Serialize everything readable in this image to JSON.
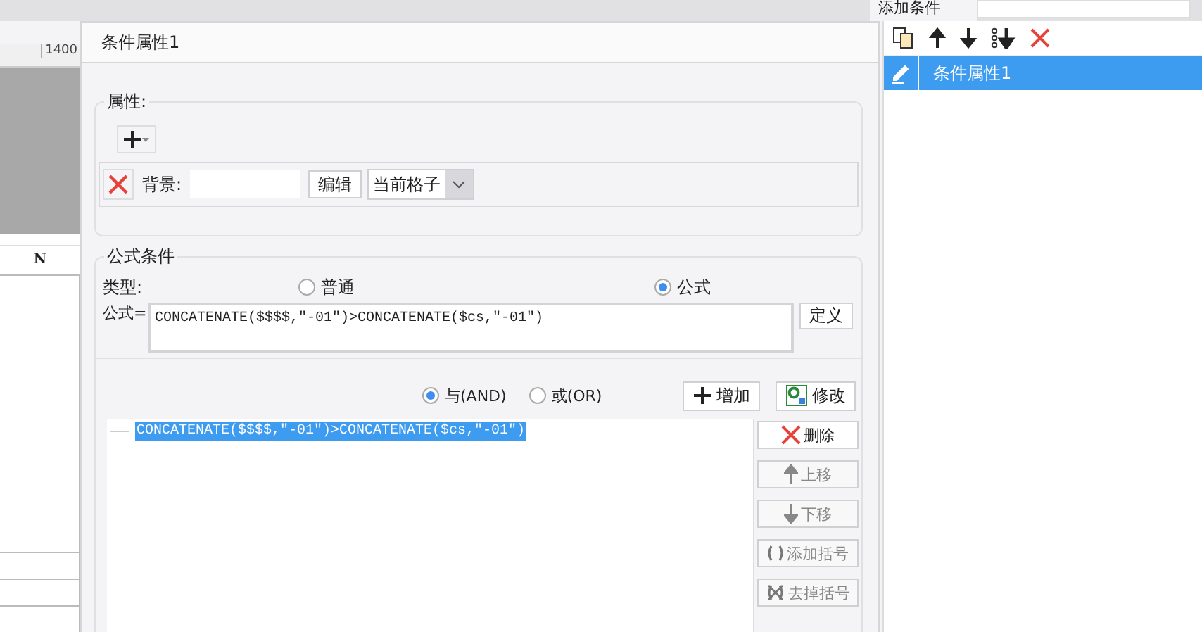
{
  "left_pane": {
    "ruler_label": "1400",
    "column_header": "N"
  },
  "dialog": {
    "title": "条件属性1",
    "properties": {
      "legend": "属性:",
      "items": [
        {
          "label": "背景:",
          "edit_button": "编辑",
          "scope": "当前格子"
        }
      ]
    },
    "formula_condition": {
      "legend": "公式条件",
      "type_label": "类型:",
      "types": [
        {
          "label": "普通",
          "selected": false
        },
        {
          "label": "公式",
          "selected": true
        }
      ],
      "formula_label": "公式=",
      "formula": "CONCATENATE($$$$,\"-01\")>CONCATENATE($cs,\"-01\")",
      "define_button": "定义"
    },
    "logic": [
      {
        "label": "与(AND)",
        "selected": true
      },
      {
        "label": "或(OR)",
        "selected": false
      }
    ],
    "add_button": "增加",
    "modify_button": "修改",
    "conditions": [
      {
        "text": "CONCATENATE($$$$,\"-01\")>CONCATENATE($cs,\"-01\")",
        "selected": true
      }
    ],
    "side_buttons": [
      {
        "label": "删除",
        "kind": "delete",
        "disabled": false
      },
      {
        "label": "上移",
        "kind": "up",
        "disabled": true
      },
      {
        "label": "下移",
        "kind": "down",
        "disabled": true
      },
      {
        "label": "添加括号",
        "kind": "add-brackets",
        "disabled": true
      },
      {
        "label": "去掉括号",
        "kind": "remove-brackets",
        "disabled": true
      }
    ]
  },
  "right_panel": {
    "header": "添加条件",
    "items": [
      {
        "label": "条件属性1",
        "selected": true
      }
    ]
  }
}
